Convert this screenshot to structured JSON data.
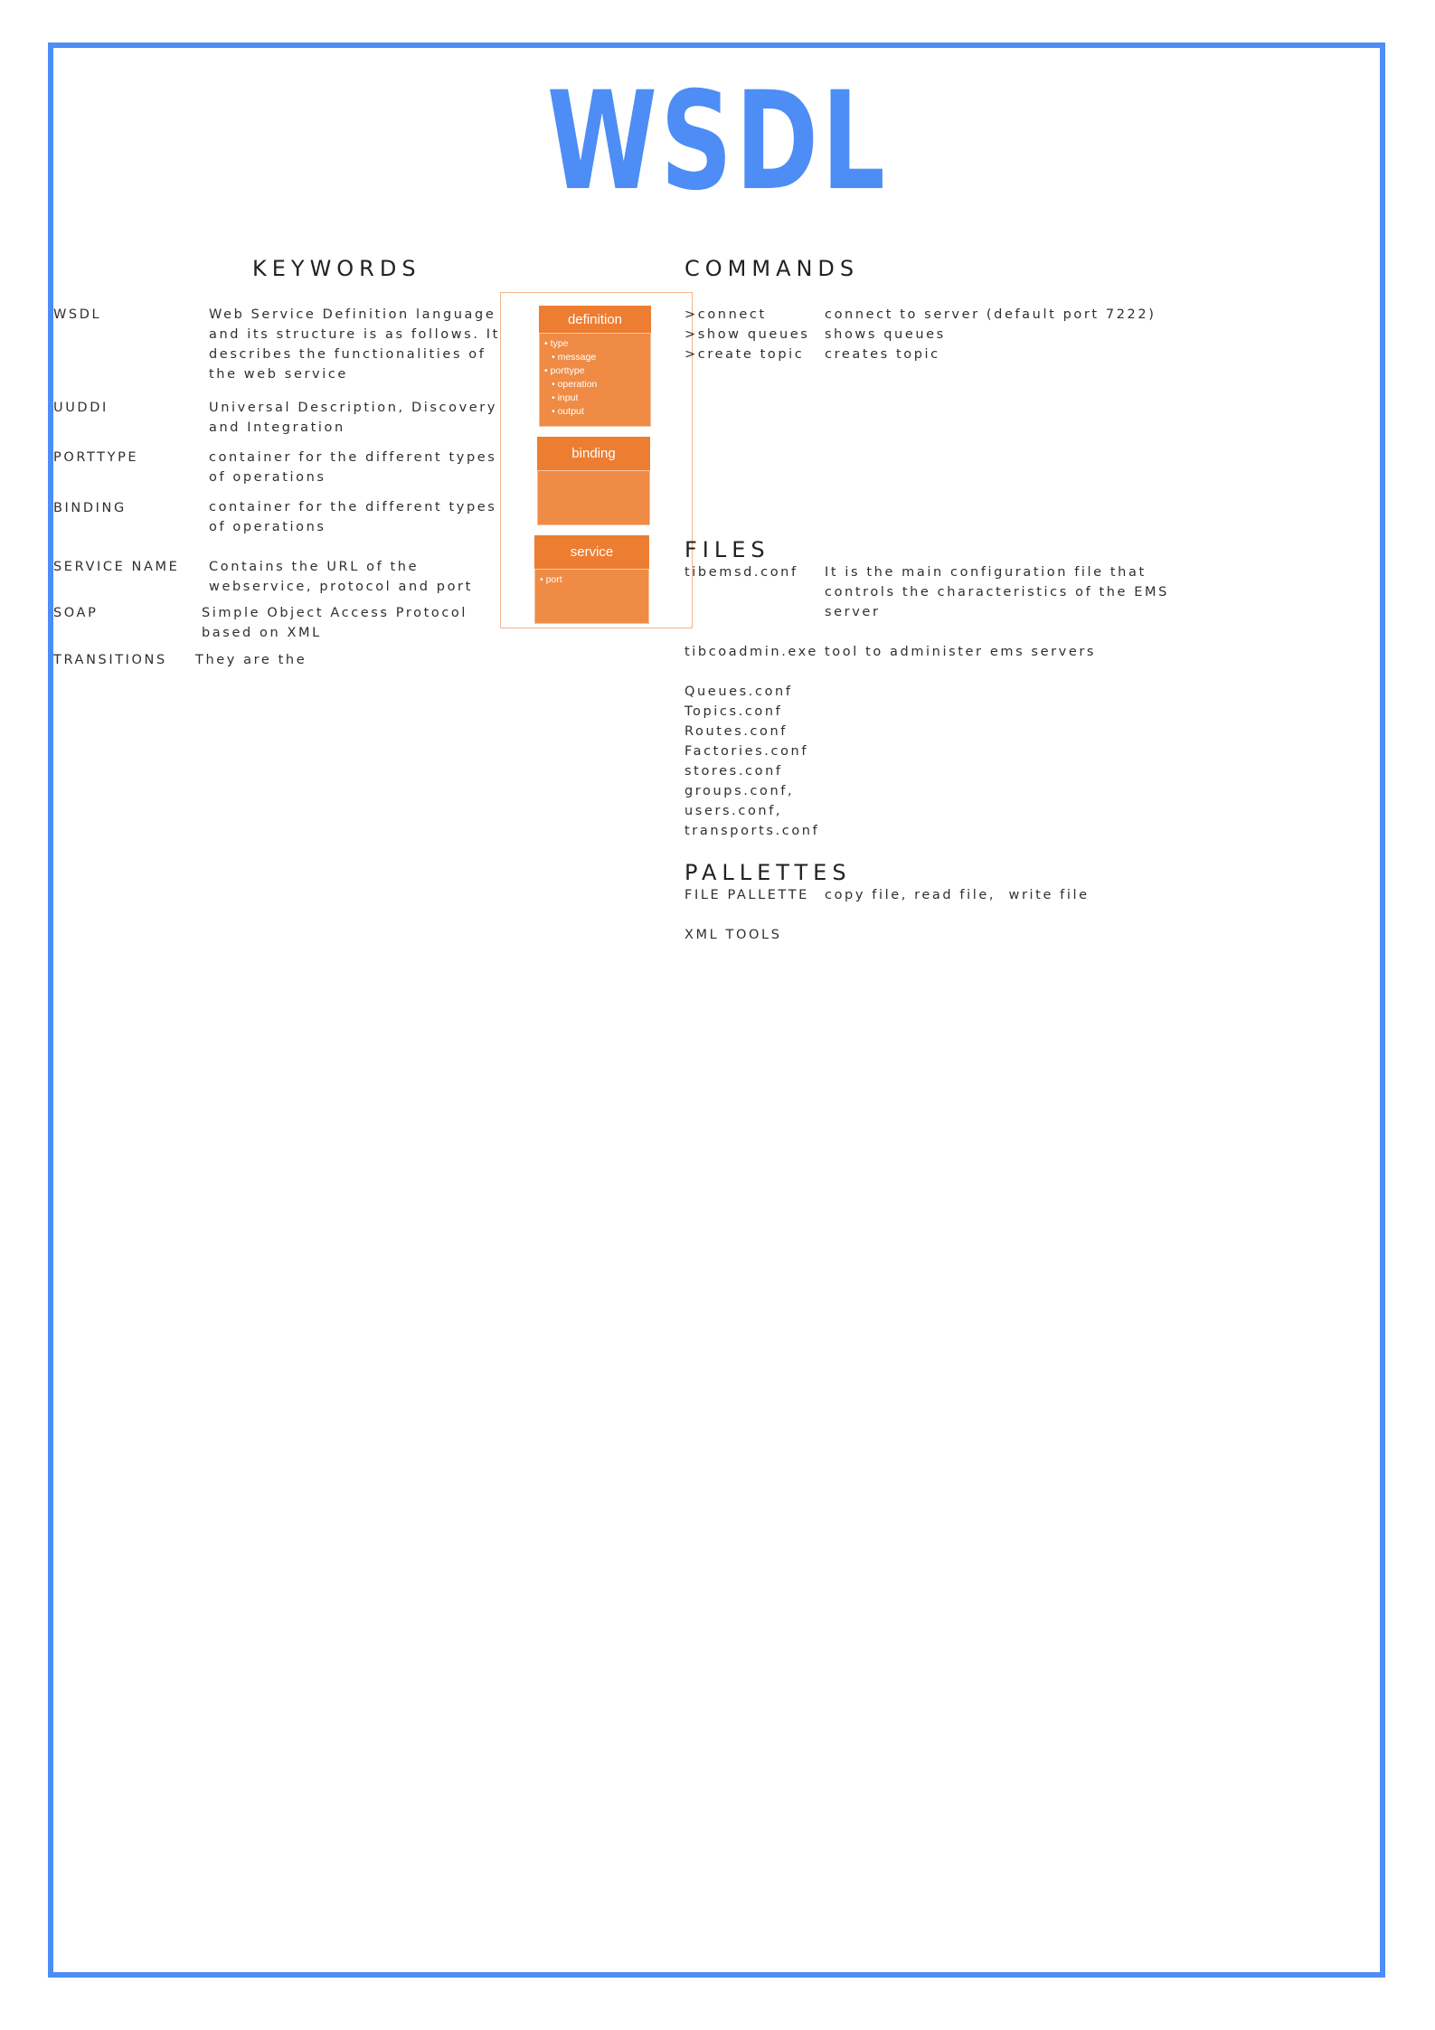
{
  "title": "WSDL",
  "keywords": {
    "heading": "KEYWORDS",
    "items": [
      {
        "term": "WSDL",
        "description": [
          "Web Service Definition language",
          "and its structure is as follows. It",
          "describes the functionalities of",
          "the web service"
        ]
      },
      {
        "term": "UUDDI",
        "description": [
          "Universal Description, Discovery",
          "and Integration"
        ]
      },
      {
        "term": "PORTTYPE",
        "description": [
          "container for the different types",
          "of operations"
        ]
      },
      {
        "term": "BINDING",
        "description": [
          "container for the different types",
          "of operations"
        ]
      },
      {
        "term": "SERVICE NAME",
        "description": [
          "Contains the URL of the",
          "webservice, protocol and port"
        ]
      },
      {
        "term": "SOAP",
        "description": [
          "Simple Object Access Protocol",
          "based on XML"
        ]
      },
      {
        "term": "TRANSITIONS",
        "description": [
          "They are the"
        ]
      }
    ]
  },
  "diagram": {
    "definition": {
      "title": "definition",
      "items": [
        "type",
        "message",
        "porttype",
        "operation",
        "input",
        "output"
      ]
    },
    "binding": {
      "title": "binding"
    },
    "service": {
      "title": "service",
      "items": [
        "port"
      ]
    }
  },
  "commands": {
    "heading": "COMMANDS",
    "items": [
      {
        "command": ">connect",
        "description": "connect to server (default port 7222)"
      },
      {
        "command": ">show queues",
        "description": "shows queues"
      },
      {
        "command": ">create topic",
        "description": "creates topic"
      }
    ]
  },
  "files": {
    "heading": "FILES",
    "items": [
      {
        "name": "tibemsd.conf",
        "description": [
          "It is the main configuration file that",
          "controls the characteristics of the EMS",
          "server"
        ]
      },
      {
        "name": "tibcoadmin.exe",
        "description": [
          "tool to administer ems servers"
        ]
      }
    ],
    "list": [
      "Queues.conf",
      "Topics.conf",
      "Routes.conf",
      "Factories.conf",
      "stores.conf",
      "groups.conf,",
      "users.conf,",
      "transports.conf"
    ]
  },
  "pallettes": {
    "heading": "PALLETTES",
    "items": [
      {
        "name": "FILE PALLETTE",
        "description": "copy file, read file,  write file"
      },
      {
        "name": "XML TOOLS",
        "description": ""
      }
    ]
  },
  "colors": {
    "accent": "#4d8df5",
    "diagram_header": "#ed7d31",
    "diagram_body": "#ef8b44",
    "diagram_border": "#f4b487"
  }
}
